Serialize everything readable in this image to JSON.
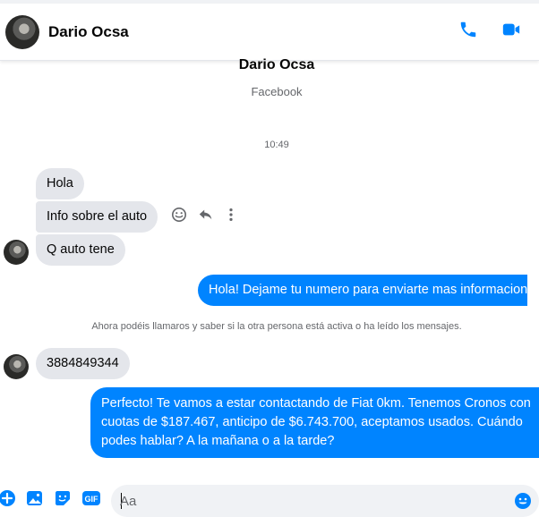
{
  "header": {
    "name": "Dario Ocsa"
  },
  "profile": {
    "name": "Dario Ocsa",
    "source": "Facebook"
  },
  "timestamp": "10:49",
  "messages": [
    {
      "text": "Hola"
    },
    {
      "text": "Info sobre el auto"
    },
    {
      "text": "Q auto tene"
    },
    {
      "text": "Hola! Dejame tu numero para enviarte mas informacion"
    },
    {
      "text": "3884849344"
    },
    {
      "text": "Perfecto! Te vamos a estar contactando de Fiat 0km. Tenemos Cronos con cuotas de $187.467, anticipo de $6.743.700, aceptamos usados. Cuándo podes hablar? A la mañana o a la tarde?"
    }
  ],
  "notice": "Ahora podéis llamaros y saber si la otra persona está activa o ha leído los mensajes.",
  "composer": {
    "placeholder": "Aa"
  },
  "colors": {
    "accent": "#0084ff",
    "incoming_bubble": "#e4e6eb",
    "muted_text": "#65676b"
  },
  "icons": {
    "call": "phone-icon",
    "video": "video-camera-icon",
    "react": "smile-icon",
    "reply": "reply-icon",
    "more": "more-vertical-icon",
    "plus": "plus-icon",
    "image": "image-icon",
    "sticker": "sticker-icon",
    "gif": "gif-icon",
    "emoji": "emoji-icon"
  }
}
